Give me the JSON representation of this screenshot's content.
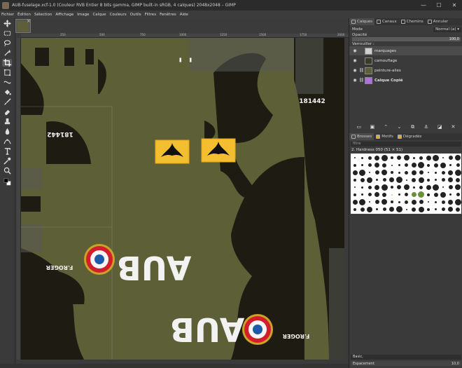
{
  "window": {
    "title": "AUB-fuselage.xcf-1.0 (Couleur RVB Entier 8 bits gamma, GIMP built-in sRGB, 4 calques) 2048x2048 – GIMP",
    "minimize": "—",
    "maximize": "☐",
    "close": "✕"
  },
  "menu": [
    "Fichier",
    "Édition",
    "Sélection",
    "Affichage",
    "Image",
    "Calque",
    "Couleurs",
    "Outils",
    "Filtres",
    "Fenêtres",
    "Aide"
  ],
  "rulers": {
    "h": [
      "250",
      "500",
      "750",
      "1000",
      "1250",
      "1500",
      "1750",
      "2000"
    ]
  },
  "canvas_text": {
    "serial_left": "181442",
    "serial_right": "181442",
    "aub_top": "AUB",
    "aub_bottom": "AUB",
    "name_left": "F.ROGER",
    "name_right": "F.ROGER",
    "mark_top": "' '"
  },
  "dock": {
    "tabs": [
      "Calques",
      "Canaux",
      "Chemins",
      "Annuler"
    ],
    "mode_label": "Mode",
    "mode_value": "Normal (a)",
    "opacity_label": "Opacité",
    "opacity_value": "100,0",
    "opacity_fraction": 1.0,
    "lock_label": "Verrouiller :",
    "layers": [
      {
        "name": "marquages",
        "thumb_color": "#cfcfcf",
        "chain": false,
        "selected": true,
        "bold": false
      },
      {
        "name": "camouflage",
        "thumb_color": "#3b3a28",
        "chain": false,
        "selected": false,
        "bold": false
      },
      {
        "name": "peinture-ailes",
        "thumb_color": "#5d5f37",
        "chain": true,
        "selected": false,
        "bold": false
      },
      {
        "name": "Calque Copié",
        "thumb_color": "#b36fd8",
        "chain": true,
        "selected": false,
        "bold": true
      }
    ],
    "brush_tabs": [
      "Brosses",
      "Motifs",
      "Dégradés"
    ],
    "filter_placeholder": "filtre",
    "brush_name": "2. Hardness 050 (51 × 51)",
    "preset": "Basic,",
    "spacing_label": "Espacement",
    "spacing_value": "10,0"
  },
  "colors": {
    "olive": "#5d5f37",
    "camo_dark": "#1e1c12",
    "badge_yellow": "#f3be2f",
    "roundel_red": "#d21e2a",
    "roundel_blue": "#1d5aa8"
  }
}
